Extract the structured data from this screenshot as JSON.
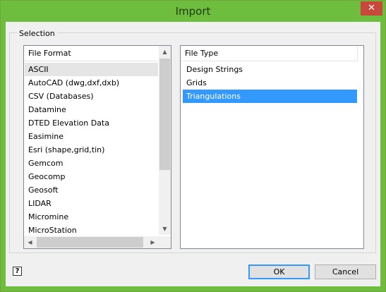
{
  "window": {
    "title": "Import",
    "close_glyph": "✕"
  },
  "selection": {
    "label": "Selection"
  },
  "format_list": {
    "header": "File Format",
    "items": [
      "ASCII",
      "AutoCAD (dwg,dxf,dxb)",
      "CSV (Databases)",
      "Datamine",
      "DTED Elevation Data",
      "Easimine",
      "Esri (shape,grid,tin)",
      "Gemcom",
      "Geocomp",
      "Geosoft",
      "LIDAR",
      "Micromine",
      "MicroStation"
    ],
    "hovered_item": "ASCII"
  },
  "type_list": {
    "header": "File Type",
    "items": [
      "Design Strings",
      "Grids",
      "Triangulations"
    ],
    "selected_item": "Triangulations"
  },
  "scroll_glyphs": {
    "up": "▲",
    "down": "▼",
    "left": "◀",
    "right": "▶"
  },
  "buttons": {
    "ok": "OK",
    "cancel": "Cancel"
  },
  "help": {
    "glyph": "?"
  },
  "colors": {
    "title_bar": "#6fbd3f",
    "selection": "#3399ff",
    "close": "#c9483c"
  }
}
